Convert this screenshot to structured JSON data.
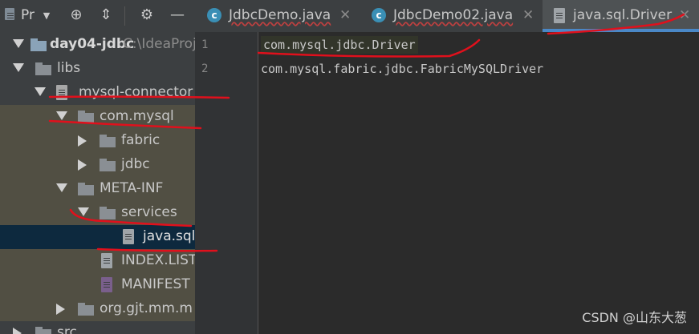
{
  "project_panel": {
    "title": "Pr",
    "tree": [
      {
        "label": "day04-jdbc",
        "extra": "C:\\IdeaProj",
        "kind": "module"
      },
      {
        "label": "libs",
        "kind": "folder"
      },
      {
        "label": "mysql-connector",
        "kind": "jar"
      },
      {
        "label": "com.mysql",
        "kind": "package"
      },
      {
        "label": "fabric",
        "kind": "package"
      },
      {
        "label": "jdbc",
        "kind": "package"
      },
      {
        "label": "META-INF",
        "kind": "folder"
      },
      {
        "label": "services",
        "kind": "folder"
      },
      {
        "label": "java.sql",
        "kind": "file"
      },
      {
        "label": "INDEX.LIST",
        "kind": "file"
      },
      {
        "label": "MANIFEST",
        "kind": "manifest"
      },
      {
        "label": "org.gjt.mm.m",
        "kind": "package"
      },
      {
        "label": "src",
        "kind": "folder"
      }
    ]
  },
  "tabs": [
    {
      "label": "JdbcDemo.java",
      "icon": "java-class-icon"
    },
    {
      "label": "JdbcDemo02.java",
      "icon": "java-class-icon"
    },
    {
      "label": "java.sql.Driver",
      "icon": "text-file-icon",
      "active": true
    }
  ],
  "editor": {
    "line_numbers": [
      "1",
      "2"
    ],
    "lines": [
      "com.mysql.jdbc.Driver",
      "com.mysql.fabric.jdbc.FabricMySQLDriver"
    ]
  },
  "watermark": "CSDN @山东大葱",
  "annotation_color": "#e0101c"
}
